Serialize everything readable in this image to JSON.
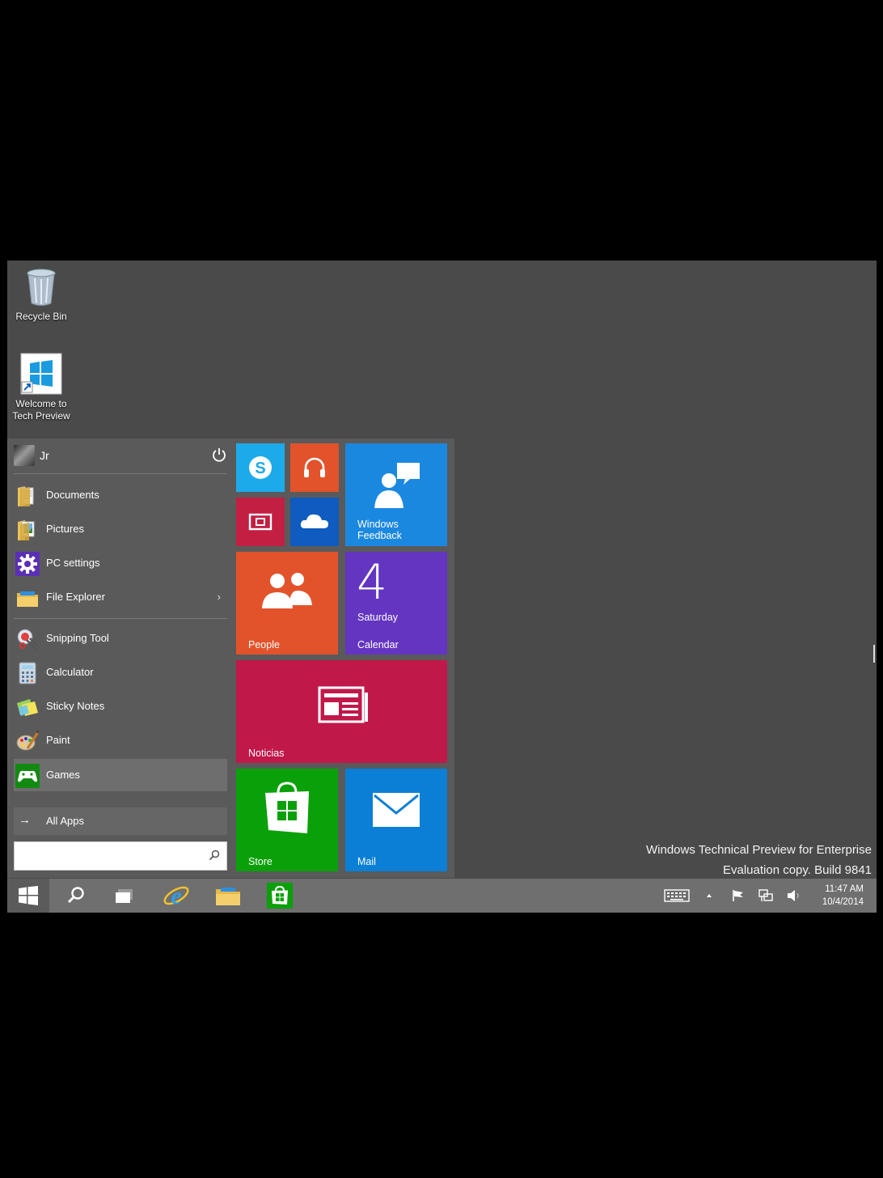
{
  "desktop": {
    "icons": [
      {
        "label": "Recycle Bin",
        "icon": "recycle-bin-icon"
      },
      {
        "label": "Welcome to\nTech Preview",
        "icon": "windows-logo-shortcut-icon"
      }
    ],
    "watermark": {
      "line1": "Windows Technical Preview for Enterprise",
      "line2": "Evaluation copy. Build 9841"
    },
    "background_color": "#4a4a4a"
  },
  "start_menu": {
    "user": {
      "name": "Jr",
      "power_icon": "power-icon"
    },
    "places": [
      {
        "label": "Documents",
        "icon": "documents-icon"
      },
      {
        "label": "Pictures",
        "icon": "pictures-icon"
      },
      {
        "label": "PC settings",
        "icon": "gear-icon"
      },
      {
        "label": "File Explorer",
        "icon": "file-explorer-icon",
        "chevron": "›"
      }
    ],
    "apps": [
      {
        "label": "Snipping Tool",
        "icon": "snipping-tool-icon"
      },
      {
        "label": "Calculator",
        "icon": "calculator-icon"
      },
      {
        "label": "Sticky Notes",
        "icon": "sticky-notes-icon"
      },
      {
        "label": "Paint",
        "icon": "paint-icon"
      },
      {
        "label": "Games",
        "icon": "games-controller-icon",
        "selected": true
      }
    ],
    "all_apps": {
      "label": "All Apps",
      "arrow": "→"
    },
    "search": {
      "value": "",
      "placeholder": ""
    },
    "tiles": [
      {
        "id": "skype",
        "label": "",
        "icon": "skype-icon",
        "color": "#1daaea"
      },
      {
        "id": "music",
        "label": "",
        "icon": "headphones-icon",
        "color": "#e2522b"
      },
      {
        "id": "video",
        "label": "",
        "icon": "video-icon",
        "color": "#c31f43"
      },
      {
        "id": "onedrive",
        "label": "",
        "icon": "cloud-icon",
        "color": "#0f5bbf"
      },
      {
        "id": "feedback",
        "label": "Windows\nFeedback",
        "icon": "feedback-person-icon",
        "color": "#1b88e0"
      },
      {
        "id": "people",
        "label": "People",
        "icon": "people-icon",
        "color": "#e2532b"
      },
      {
        "id": "calendar",
        "label": "Calendar",
        "day_number": "4",
        "day_name": "Saturday",
        "color": "#6335c1"
      },
      {
        "id": "news",
        "label": "Noticias",
        "icon": "news-icon",
        "color": "#c1184a"
      },
      {
        "id": "store",
        "label": "Store",
        "icon": "store-bag-icon",
        "color": "#0aa00a"
      },
      {
        "id": "mail",
        "label": "Mail",
        "icon": "mail-envelope-icon",
        "color": "#0a7fd5"
      }
    ]
  },
  "taskbar": {
    "pinned": [
      {
        "name": "start",
        "icon": "windows-start-icon"
      },
      {
        "name": "search",
        "icon": "search-icon"
      },
      {
        "name": "task-view",
        "icon": "task-view-icon"
      },
      {
        "name": "internet-explorer",
        "icon": "internet-explorer-icon"
      },
      {
        "name": "file-explorer",
        "icon": "folder-icon"
      },
      {
        "name": "store",
        "icon": "store-icon"
      }
    ],
    "tray": [
      "keyboard-icon",
      "show-hidden-icons-icon",
      "action-center-flag-icon",
      "network-icon",
      "volume-icon"
    ],
    "clock": {
      "time": "11:47 AM",
      "date": "10/4/2014"
    }
  }
}
